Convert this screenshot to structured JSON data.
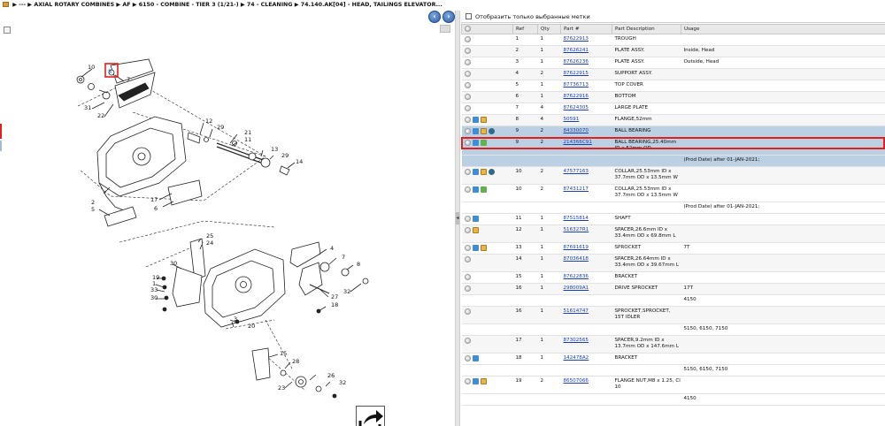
{
  "breadcrumb": {
    "items": [
      "▶ ---",
      "▶ AXIAL ROTARY COMBINES",
      "▶ AF",
      "▶ 6150 - COMBINE - TIER 3 (1/21-)",
      "▶ 74 - CLEANING",
      "▶ 74.140.AK[04] - HEAD, TAILINGS ELEVATOR..."
    ]
  },
  "diagram": {
    "callouts": [
      "10",
      "8",
      "31",
      "22",
      "7",
      "12",
      "29",
      "21",
      "11",
      "13",
      "29",
      "14",
      "2",
      "5",
      "17",
      "6",
      "25",
      "24",
      "4",
      "7",
      "8",
      "30",
      "19",
      "1",
      "33",
      "30",
      "27",
      "18",
      "32",
      "3",
      "20",
      "15",
      "28",
      "26",
      "32",
      "23"
    ]
  },
  "filter": {
    "label": "Отобразить только выбранные метки"
  },
  "table": {
    "headers": [
      "",
      "Ref",
      "Qty",
      "Part #",
      "Part Description",
      "Usage"
    ],
    "rows": [
      {
        "ref": "1",
        "qty": "1",
        "part": "87622913",
        "desc": "TROUGH",
        "usage": "",
        "icons": [],
        "kind": "r1"
      },
      {
        "ref": "2",
        "qty": "1",
        "part": "87626241",
        "desc": "PLATE ASSY.",
        "usage": "Inside, Head",
        "icons": [],
        "kind": "r1"
      },
      {
        "ref": "3",
        "qty": "1",
        "part": "87626236",
        "desc": "PLATE ASSY.",
        "usage": "Outside, Head",
        "icons": [],
        "kind": "r1"
      },
      {
        "ref": "4",
        "qty": "2",
        "part": "87622915",
        "desc": "SUPPORT ASSY.",
        "usage": "",
        "icons": [],
        "kind": "r1"
      },
      {
        "ref": "5",
        "qty": "1",
        "part": "87736713",
        "desc": "TOP COVER",
        "usage": "",
        "icons": [],
        "kind": "r1"
      },
      {
        "ref": "6",
        "qty": "1",
        "part": "87622916",
        "desc": "BOTTOM",
        "usage": "",
        "icons": [],
        "kind": "r1"
      },
      {
        "ref": "7",
        "qty": "4",
        "part": "87624305",
        "desc": "LARGE PLATE",
        "usage": "",
        "icons": [],
        "kind": "r1"
      },
      {
        "ref": "8",
        "qty": "4",
        "part": "50591",
        "desc": "FLANGE,52mm",
        "usage": "",
        "icons": [
          "swap",
          "pkg"
        ],
        "kind": "r1"
      },
      {
        "ref": "9",
        "qty": "2",
        "part": "84330070",
        "desc": "BALL BEARING",
        "usage": "",
        "icons": [
          "swap",
          "pkg",
          "info"
        ],
        "kind": "r1",
        "selected": true
      },
      {
        "ref": "9",
        "qty": "2",
        "part": "214366C91",
        "desc": "BALL BEARING,25.40mm ID x 52mm OD",
        "usage": "",
        "icons": [
          "swap",
          "arrow"
        ],
        "kind": "r2",
        "selected": true
      },
      {
        "note": "(Prod Date) after 01-JAN-2021;",
        "selected": true
      },
      {
        "ref": "10",
        "qty": "2",
        "part": "47577163",
        "desc": "COLLAR,25.53mm ID x 37.7mm OD x 13.5mm W",
        "usage": "",
        "icons": [
          "swap",
          "pkg",
          "info"
        ],
        "kind": "r2"
      },
      {
        "ref": "10",
        "qty": "2",
        "part": "87431217",
        "desc": "COLLAR,25.53mm ID x 37.7mm OD x 13.5mm W",
        "usage": "",
        "icons": [
          "swap",
          "arrow"
        ],
        "kind": "r2"
      },
      {
        "note": "(Prod Date) after 01-JAN-2021;"
      },
      {
        "ref": "11",
        "qty": "1",
        "part": "87515814",
        "desc": "SHAFT",
        "usage": "",
        "icons": [
          "swap"
        ],
        "kind": "r1"
      },
      {
        "ref": "12",
        "qty": "1",
        "part": "516327R1",
        "desc": "SPACER,26.6mm ID x 33.4mm OD x 69.8mm L",
        "usage": "",
        "icons": [
          "pkg"
        ],
        "kind": "r2"
      },
      {
        "ref": "13",
        "qty": "1",
        "part": "87691619",
        "desc": "SPROCKET",
        "usage": "7T",
        "icons": [
          "swap",
          "pkg"
        ],
        "kind": "r1"
      },
      {
        "ref": "14",
        "qty": "1",
        "part": "87036418",
        "desc": "SPACER,26.64mm ID x 33.4mm OD x 39.67mm L",
        "usage": "",
        "icons": [],
        "kind": "r2"
      },
      {
        "ref": "15",
        "qty": "1",
        "part": "87622836",
        "desc": "BRACKET",
        "usage": "",
        "icons": [],
        "kind": "r1"
      },
      {
        "ref": "16",
        "qty": "1",
        "part": "298009A1",
        "desc": "DRIVE SPROCKET",
        "usage": "17T",
        "icons": [],
        "kind": "r1"
      },
      {
        "note": "4150"
      },
      {
        "ref": "16",
        "qty": "1",
        "part": "51614747",
        "desc": "SPROCKET,SPROCKET, 15T IDLER",
        "usage": "",
        "icons": [],
        "kind": "r2"
      },
      {
        "note": "5150, 6150, 7150"
      },
      {
        "ref": "17",
        "qty": "1",
        "part": "87302565",
        "desc": "SPACER,9.2mm ID x 13.7mm OD x 147.6mm L",
        "usage": "",
        "icons": [],
        "kind": "r2"
      },
      {
        "ref": "18",
        "qty": "1",
        "part": "142478A2",
        "desc": "BRACKET",
        "usage": "",
        "icons": [
          "swap"
        ],
        "kind": "r1"
      },
      {
        "note": "5150, 6150, 7150"
      },
      {
        "ref": "19",
        "qty": "2",
        "part": "86507066",
        "desc": "FLANGE NUT,M8 x 1.25, Cl 10",
        "usage": "",
        "icons": [
          "swap",
          "pkg"
        ],
        "kind": "r2"
      },
      {
        "note": "4150"
      }
    ]
  }
}
